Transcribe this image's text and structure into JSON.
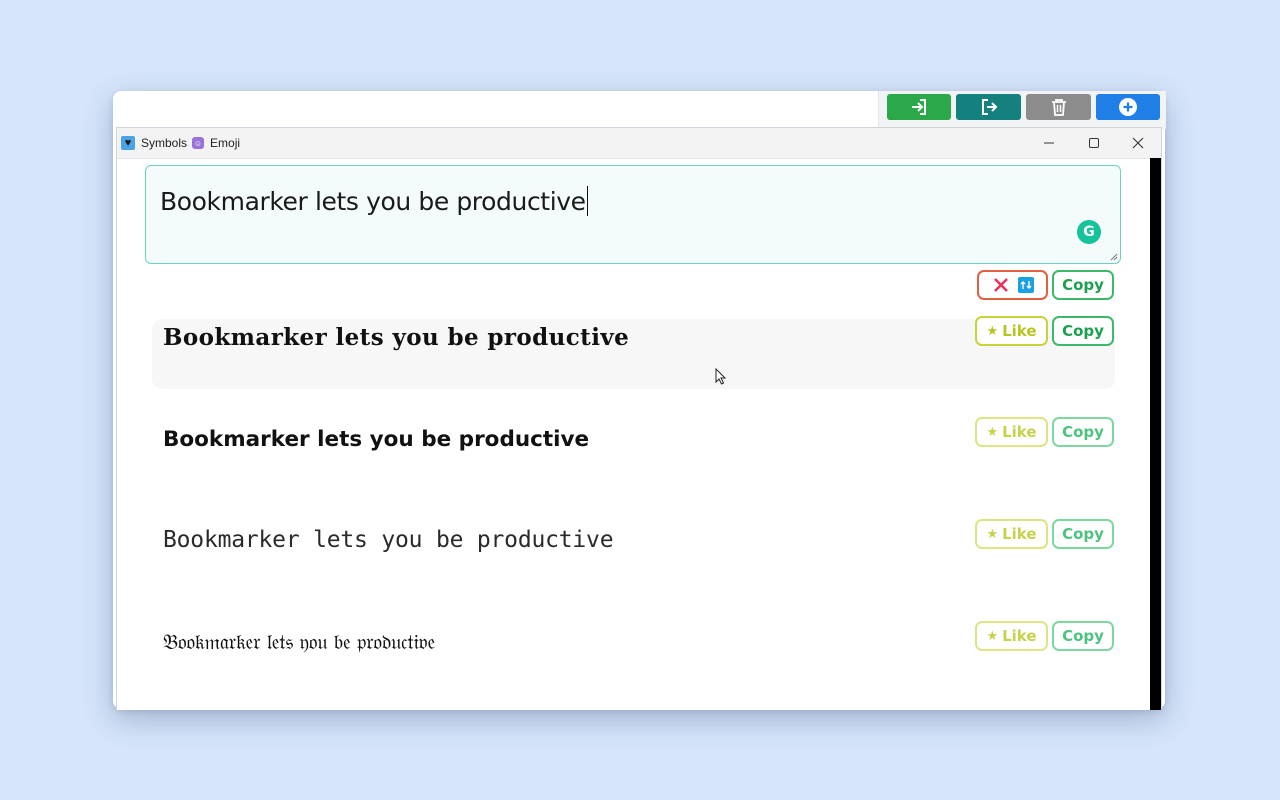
{
  "window": {
    "title_symbols": "Symbols",
    "title_emoji": "Emoji"
  },
  "toolbar": {
    "buttons": [
      {
        "icon": "sign-in-icon",
        "color": "#2aa84a"
      },
      {
        "icon": "sign-out-icon",
        "color": "#15817f"
      },
      {
        "icon": "trash-icon",
        "color": "#8c8c8c"
      },
      {
        "icon": "plus-circle-icon",
        "color": "#1f7fe6"
      }
    ]
  },
  "editor": {
    "value": "Bookmarker lets you be productive"
  },
  "actions": {
    "copy_label": "Copy",
    "like_label": "Like"
  },
  "variants": [
    {
      "text": "Bookmarker lets you be productive"
    },
    {
      "text": "Bookmarker lets you be productive"
    },
    {
      "text": "Bookmarker lets you be productive"
    },
    {
      "text": "𝔅𝔬𝔬𝔨𝔪𝔞𝔯𝔨𝔢𝔯 𝔩𝔢𝔱𝔰 𝔶𝔬𝔲 𝔟𝔢 𝔭𝔯𝔬𝔡𝔲𝔠𝔱𝔦𝔳𝔢"
    }
  ],
  "colors": {
    "copy": "#1aa04f",
    "like": "#b7c51f",
    "clear": "#e0603f",
    "editor_border": "#6fd0c0"
  }
}
